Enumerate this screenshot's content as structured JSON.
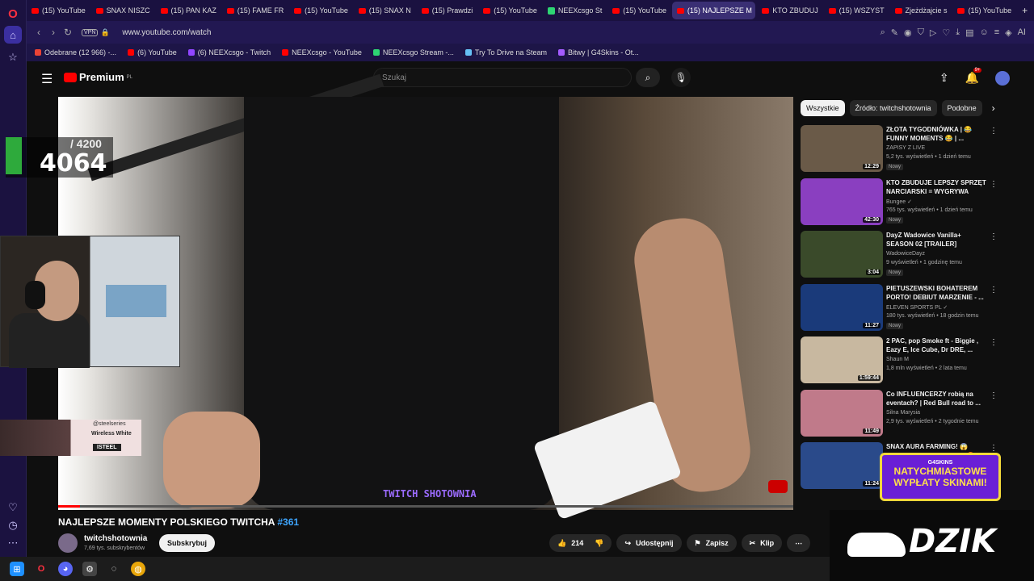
{
  "browser": {
    "tabs": [
      {
        "label": "(15) YouTube",
        "icon": "youtube",
        "active": false
      },
      {
        "label": "SNAX NISZC",
        "icon": "youtube",
        "active": false
      },
      {
        "label": "(15) PAN KAZ",
        "icon": "youtube",
        "active": false
      },
      {
        "label": "(15) FAME FR",
        "icon": "youtube",
        "active": false
      },
      {
        "label": "(15) YouTube",
        "icon": "youtube",
        "active": false
      },
      {
        "label": "(15) SNAX N",
        "icon": "youtube",
        "active": false
      },
      {
        "label": "(15) Prawdzi",
        "icon": "youtube",
        "active": false
      },
      {
        "label": "(15) YouTube",
        "icon": "youtube",
        "active": false
      },
      {
        "label": "NEEXcsgo St",
        "icon": "kick",
        "active": false
      },
      {
        "label": "(15) YouTube",
        "icon": "youtube",
        "active": false
      },
      {
        "label": "(15) NAJLEPSZE M",
        "icon": "youtube",
        "active": true
      },
      {
        "label": "KTO ZBUDUJ",
        "icon": "youtube",
        "active": false
      },
      {
        "label": "(15) WSZYST",
        "icon": "youtube",
        "active": false
      },
      {
        "label": "Zjeżdżajcie s",
        "icon": "youtube",
        "active": false
      },
      {
        "label": "(15) YouTube",
        "icon": "youtube",
        "active": false
      }
    ],
    "vpn_label": "VPN",
    "url": "www.youtube.com/watch",
    "ai_label": "AI",
    "bookmarks": [
      {
        "label": "Odebrane (12 966) -...",
        "color": "#ea4335"
      },
      {
        "label": "(6) YouTube",
        "color": "#ff0000"
      },
      {
        "label": "(6) NEEXcsgo - Twitch",
        "color": "#9146ff"
      },
      {
        "label": "NEEXcsgo - YouTube",
        "color": "#ff0000"
      },
      {
        "label": "NEEXcsgo Stream -...",
        "color": "#2ed573"
      },
      {
        "label": "Try To Drive na Steam",
        "color": "#66c0f4"
      },
      {
        "label": "Bitwy | G4Skins - Ot...",
        "color": "#a45cff"
      }
    ]
  },
  "youtube": {
    "logo_text": "Premium",
    "logo_region": "PL",
    "search_placeholder": "Szukaj",
    "notif_count": "9+",
    "video": {
      "title": "NAJLEPSZE MOMENTY POLSKIEGO TWITCHA",
      "title_tag": "#361",
      "channel": "twitchshotownia",
      "subscribers": "7,69 tys. subskrybentów",
      "subscribe_label": "Subskrybuj",
      "likes": "214",
      "share_label": "Udostępnij",
      "save_label": "Zapisz",
      "clip_label": "Klip",
      "progress": 0.03,
      "watermark": "TWITCH SHOTOWNIA"
    },
    "overlay": {
      "counter_goal": "/ 4200",
      "counter_value": "4064",
      "ad_brand": "@steelseries",
      "ad_product": "Wireless White",
      "ad_tag": "ISTEEL"
    },
    "chips": [
      "Wszystkie",
      "Źródło: twitchshotownia",
      "Podobne"
    ],
    "recommendations": [
      {
        "title": "ZŁOTA TYGODNIÓWKA | 😂 FUNNY MOMENTS 😂 | ...",
        "channel": "ZAPISY Z LIVE",
        "meta": "5,2 tys. wyświetleń • 1 dzień temu",
        "duration": "12:29",
        "new": "Nowy",
        "thumb": "#6a5a48"
      },
      {
        "title": "KTO ZBUDUJE LEPSZY SPRZĘT NARCIARSKI = WYGRYWA",
        "channel": "Bungee ✓",
        "meta": "765 tys. wyświetleń • 1 dzień temu",
        "duration": "42:30",
        "new": "Nowy",
        "thumb": "#8a3fc0"
      },
      {
        "title": "DayZ Wadowice Vanilla+ SEASON 02 [TRAILER]",
        "channel": "WadowiceDayz",
        "meta": "9 wyświetleń • 1 godzinę temu",
        "duration": "3:04",
        "new": "Nowy",
        "thumb": "#3a4a2a"
      },
      {
        "title": "PIETUSZEWSKI BOHATEREM PORTO! DEBIUT MARZENIE - ...",
        "channel": "ELEVEN SPORTS PL ✓",
        "meta": "180 tys. wyświetleń • 18 godzin temu",
        "duration": "11:27",
        "new": "Nowy",
        "thumb": "#1a3a7a"
      },
      {
        "title": "2 PAC, pop Smoke ft - Biggie , Eazy E, Ice Cube, Dr DRE, ...",
        "channel": "Shaun M",
        "meta": "1,8 mln wyświetleń • 2 lata temu",
        "duration": "1:59:44",
        "new": "",
        "thumb": "#c8b8a0"
      },
      {
        "title": "Co INFLUENCERZY robią na eventach? | Red Bull road to ...",
        "channel": "Silna Marysia",
        "meta": "2,9 tys. wyświetleń • 2 tygodnie temu",
        "duration": "11:49",
        "new": "",
        "thumb": "#c07a8a"
      },
      {
        "title": "SNAX AURA FARMING! 😱 PEVOR OSTRO O VALVE! 🤬 ...",
        "channel": "",
        "meta": "",
        "duration": "11:24",
        "new": "",
        "thumb": "#2a4a8a"
      }
    ],
    "promo": {
      "brand": "G4SKINS",
      "line1": "NATYCHMIASTOWE",
      "line2": "WYPŁATY SKINAMI!"
    },
    "dzik_text": "DZIK"
  }
}
